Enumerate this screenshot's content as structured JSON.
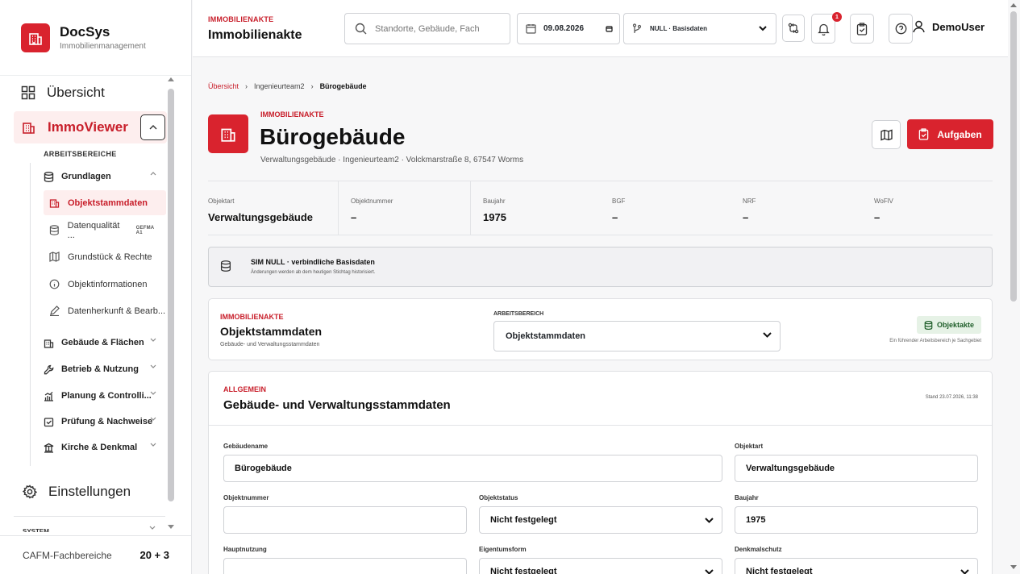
{
  "sidebar": {
    "brand": {
      "name": "DocSys",
      "subtitle": "Immobilienmanagement"
    },
    "overview_label": "Übersicht",
    "immoviewer_label": "ImmoViewer",
    "section_label": "ARBEITSBEREICHE",
    "groups": [
      {
        "label": "Grundlagen",
        "icon": "database-icon"
      },
      {
        "label": "Gebäude & Flächen",
        "icon": "building-icon"
      },
      {
        "label": "Betrieb & Nutzung",
        "icon": "wrench-icon"
      },
      {
        "label": "Planung & Controlli...",
        "icon": "chart-icon"
      },
      {
        "label": "Prüfung & Nachweise",
        "icon": "check-icon"
      },
      {
        "label": "Kirche & Denkmal",
        "icon": "monument-icon"
      }
    ],
    "subitems": [
      {
        "label": "Objektstammdaten",
        "icon": "building-icon"
      },
      {
        "label": "Datenqualität ...",
        "badge": "GEFMA A1",
        "icon": "database-icon"
      },
      {
        "label": "Grundstück & Rechte",
        "icon": "map-icon"
      },
      {
        "label": "Objektinformationen",
        "icon": "info-icon"
      },
      {
        "label": "Datenherkunft & Bearb...",
        "icon": "pen-icon"
      }
    ],
    "settings_label": "Einstellungen",
    "system_label": "SYSTEM",
    "footer": {
      "label": "CAFM-Fachbereiche",
      "count": "20 + 3"
    }
  },
  "header": {
    "eyebrow": "IMMOBILIENAKTE",
    "title": "Immobilienakte",
    "search_placeholder": "Standorte, Gebäude, Fach",
    "date": "09.08.2026",
    "null_select": "NULL · Basisdaten",
    "notification_count": "1",
    "user": "DemoUser"
  },
  "breadcrumb": [
    "Übersicht",
    "Ingenieurteam2",
    "Bürogebäude"
  ],
  "hero": {
    "eyebrow": "IMMOBILIENAKTE",
    "title": "Bürogebäude",
    "subtitle": "Verwaltungsgebäude · Ingenieurteam2 · Volckmarstraße 8, 67547 Worms",
    "tasks_label": "Aufgaben"
  },
  "facts": [
    {
      "label": "Objektart",
      "value": "Verwaltungsgebäude"
    },
    {
      "label": "Objektnummer",
      "value": "–"
    },
    {
      "label": "Baujahr",
      "value": "1975"
    },
    {
      "label": "BGF",
      "value": "–"
    },
    {
      "label": "NRF",
      "value": "–"
    },
    {
      "label": "WoFlV",
      "value": "–"
    }
  ],
  "sim": {
    "title": "SIM NULL · verbindliche Basisdaten",
    "subtitle": "Änderungen werden ab dem heutigen Stichtag historisiert."
  },
  "workspace": {
    "eyebrow": "IMMOBILIENAKTE",
    "title": "Objektstammdaten",
    "subtitle": "Gebäude- und Verwaltungsstammdaten",
    "area_label": "ARBEITSBEREICH",
    "area_value": "Objektstammdaten",
    "badge": "Objektakte",
    "hint": "Ein führender Arbeitsbereich je Sachgebiet"
  },
  "general": {
    "eyebrow": "ALLGEMEIN",
    "title": "Gebäude- und Verwaltungsstammdaten",
    "stand": "Stand 23.07.2026, 11:38",
    "fields": {
      "gebaeudename": {
        "label": "Gebäudename",
        "value": "Bürogebäude"
      },
      "objektart": {
        "label": "Objektart",
        "value": "Verwaltungsgebäude"
      },
      "objektnummer": {
        "label": "Objektnummer",
        "value": ""
      },
      "objektstatus": {
        "label": "Objektstatus",
        "value": "Nicht festgelegt"
      },
      "baujahr": {
        "label": "Baujahr",
        "value": "1975"
      },
      "hauptnutzung": {
        "label": "Hauptnutzung",
        "value": ""
      },
      "eigentumsform": {
        "label": "Eigentumsform",
        "value": "Nicht festgelegt"
      },
      "denkmalschutz": {
        "label": "Denkmalschutz",
        "value": "Nicht festgelegt"
      }
    }
  },
  "colors": {
    "accent": "#d9232e",
    "accent_bg": "#fdeeee",
    "success_bg": "#e6f2e6"
  }
}
